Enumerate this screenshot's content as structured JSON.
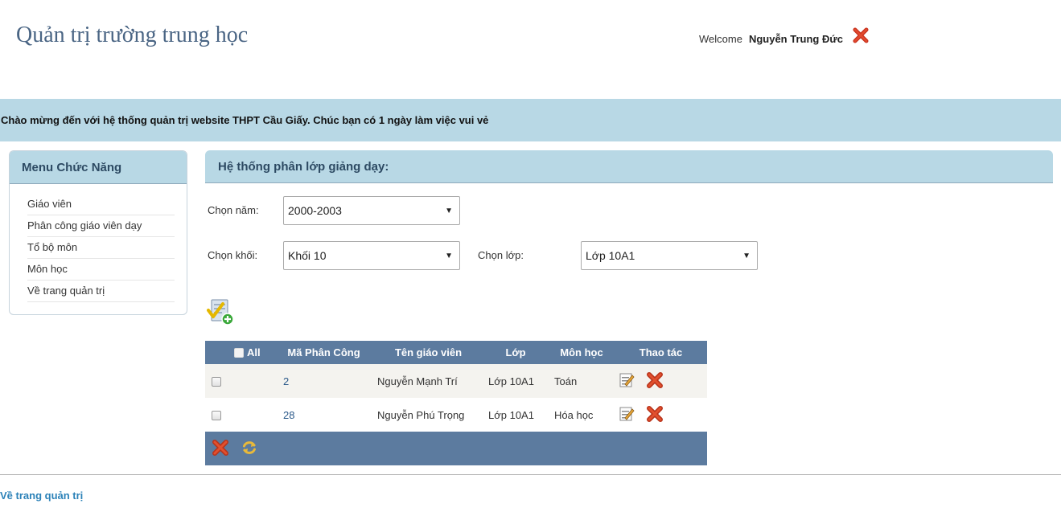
{
  "header": {
    "site_title": "Quản trị trường trung học",
    "welcome_label": "Welcome",
    "username": "Nguyễn Trung Đức",
    "logout_icon": "close-icon"
  },
  "banner": {
    "message": "Chào mừng đến với hệ thống quản trị website THPT Cầu Giấy. Chúc bạn có 1 ngày làm việc vui vẻ"
  },
  "sidebar": {
    "title": "Menu Chức Năng",
    "items": [
      {
        "label": "Giáo viên"
      },
      {
        "label": "Phân công giáo viên dạy"
      },
      {
        "label": "Tổ bộ môn"
      },
      {
        "label": "Môn học"
      },
      {
        "label": "Về trang quản trị"
      }
    ]
  },
  "panel": {
    "title": "Hệ thống phân lớp giảng dạy:"
  },
  "filters": {
    "year_label": "Chọn năm:",
    "year_value": "2000-2003",
    "grade_label": "Chọn khối:",
    "grade_value": "Khối 10",
    "class_label": "Chọn lớp:",
    "class_value": "Lớp 10A1"
  },
  "table": {
    "headers": {
      "all": "All",
      "id": "Mã Phân Công",
      "teacher": "Tên giáo viên",
      "class": "Lớp",
      "subject": "Môn học",
      "actions": "Thao tác"
    },
    "rows": [
      {
        "id": "2",
        "teacher": "Nguyễn Mạnh Trí",
        "class": "Lớp 10A1",
        "subject": "Toán"
      },
      {
        "id": "28",
        "teacher": "Nguyễn Phú Trọng",
        "class": "Lớp 10A1",
        "subject": "Hóa học"
      }
    ]
  },
  "footer": {
    "back_link": "Về trang quản trị"
  },
  "colors": {
    "accent_light": "#b8d8e5",
    "table_header": "#5c7b9f",
    "delete_red": "#d8421f",
    "link_blue": "#2c82b8"
  }
}
